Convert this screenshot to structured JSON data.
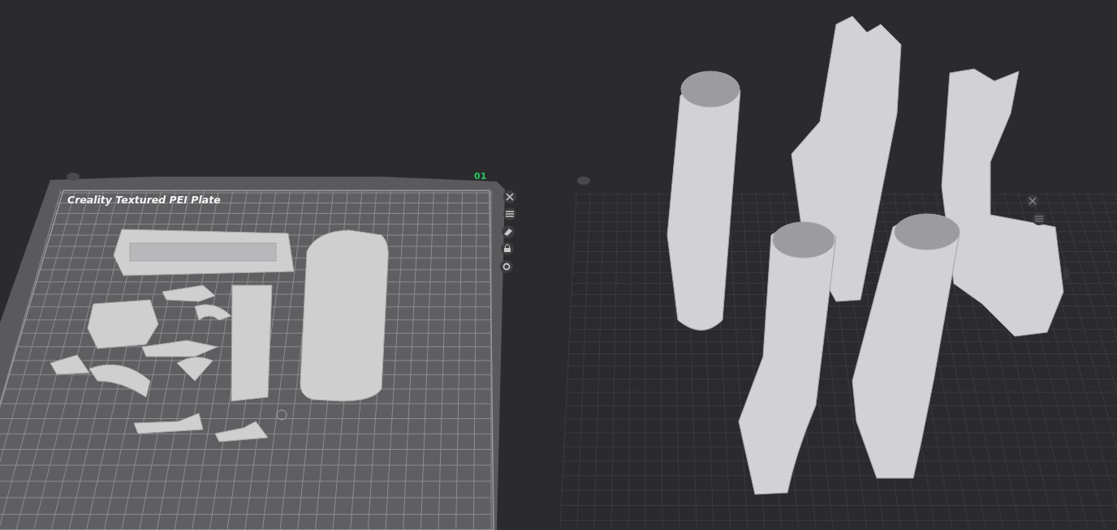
{
  "plate": {
    "label": "Creality Textured PEI Plate",
    "number": "01"
  }
}
